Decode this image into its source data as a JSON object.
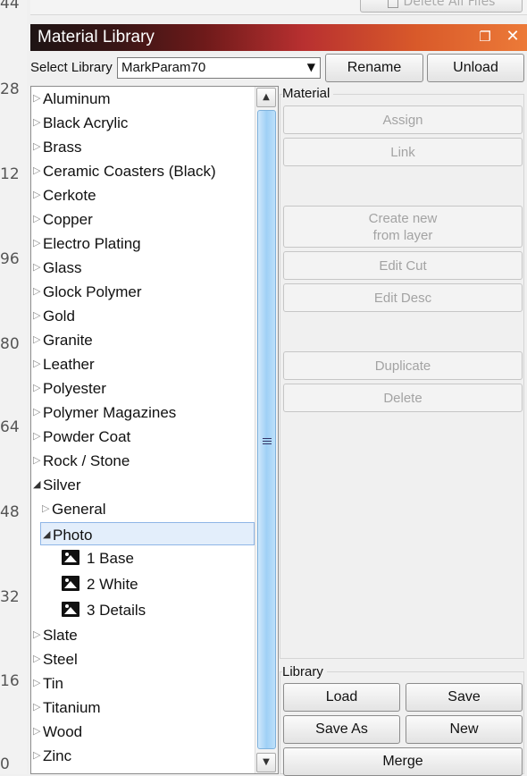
{
  "ruler": {
    "labels": [
      "44",
      "28",
      "12",
      "96",
      "80",
      "64",
      "48",
      "32",
      "16",
      "0"
    ]
  },
  "top": {
    "delete_all_label": "Delete All Files"
  },
  "window": {
    "title": "Material Library"
  },
  "select_library": {
    "label": "Select Library",
    "value": "MarkParam70"
  },
  "buttons": {
    "rename": "Rename",
    "unload": "Unload"
  },
  "tree": [
    {
      "label": "Aluminum",
      "depth": 0,
      "expanded": false
    },
    {
      "label": "Black Acrylic",
      "depth": 0,
      "expanded": false
    },
    {
      "label": "Brass",
      "depth": 0,
      "expanded": false
    },
    {
      "label": "Ceramic Coasters (Black)",
      "depth": 0,
      "expanded": false
    },
    {
      "label": "Cerkote",
      "depth": 0,
      "expanded": false
    },
    {
      "label": "Copper",
      "depth": 0,
      "expanded": false
    },
    {
      "label": "Electro Plating",
      "depth": 0,
      "expanded": false
    },
    {
      "label": "Glass",
      "depth": 0,
      "expanded": false
    },
    {
      "label": "Glock Polymer",
      "depth": 0,
      "expanded": false
    },
    {
      "label": "Gold",
      "depth": 0,
      "expanded": false
    },
    {
      "label": "Granite",
      "depth": 0,
      "expanded": false
    },
    {
      "label": "Leather",
      "depth": 0,
      "expanded": false
    },
    {
      "label": "Polyester",
      "depth": 0,
      "expanded": false
    },
    {
      "label": "Polymer Magazines",
      "depth": 0,
      "expanded": false
    },
    {
      "label": "Powder Coat",
      "depth": 0,
      "expanded": false
    },
    {
      "label": "Rock / Stone",
      "depth": 0,
      "expanded": false
    },
    {
      "label": "Silver",
      "depth": 0,
      "expanded": true
    },
    {
      "label": "General",
      "depth": 1,
      "expanded": false
    },
    {
      "label": "Photo",
      "depth": 1,
      "expanded": true,
      "selected": true
    },
    {
      "label": "1 Base",
      "depth": 2,
      "leaf": true
    },
    {
      "label": "2 White",
      "depth": 2,
      "leaf": true
    },
    {
      "label": "3 Details",
      "depth": 2,
      "leaf": true
    },
    {
      "label": "Slate",
      "depth": 0,
      "expanded": false
    },
    {
      "label": "Steel",
      "depth": 0,
      "expanded": false
    },
    {
      "label": "Tin",
      "depth": 0,
      "expanded": false
    },
    {
      "label": "Titanium",
      "depth": 0,
      "expanded": false
    },
    {
      "label": "Wood",
      "depth": 0,
      "expanded": false
    },
    {
      "label": "Zinc",
      "depth": 0,
      "expanded": false
    }
  ],
  "material": {
    "title": "Material",
    "assign": "Assign",
    "link": "Link",
    "create_new": "Create new\nfrom layer",
    "edit_cut": "Edit Cut",
    "edit_desc": "Edit Desc",
    "duplicate": "Duplicate",
    "delete": "Delete"
  },
  "library": {
    "title": "Library",
    "load": "Load",
    "save": "Save",
    "save_as": "Save As",
    "new": "New",
    "merge": "Merge"
  }
}
